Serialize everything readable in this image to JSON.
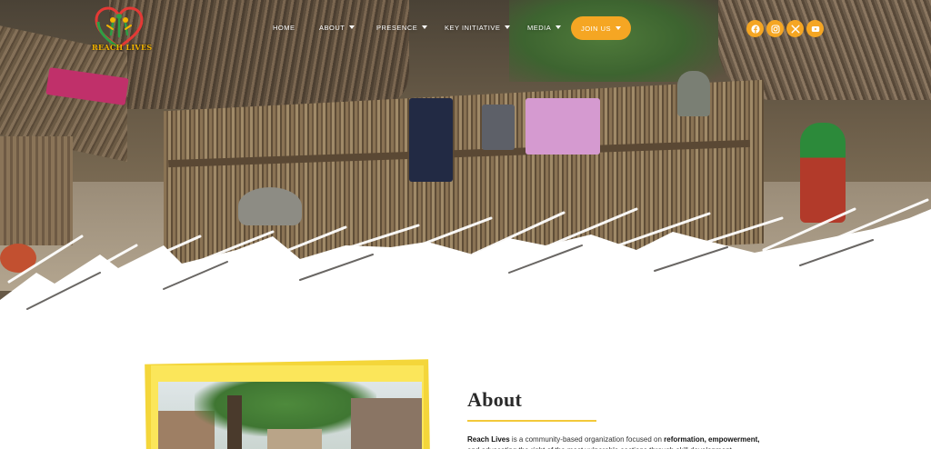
{
  "brand": {
    "name": "Reach Lives",
    "logo_text": "REACH LIVES",
    "colors": {
      "accent": "#f5a623",
      "logo_yellow": "#f3b400",
      "rule": "#f3c93a"
    }
  },
  "nav": {
    "items": [
      {
        "label": "HOME",
        "has_dropdown": false
      },
      {
        "label": "ABOUT",
        "has_dropdown": true
      },
      {
        "label": "PRESENCE",
        "has_dropdown": true
      },
      {
        "label": "KEY INITIATIVE",
        "has_dropdown": true
      },
      {
        "label": "MEDIA",
        "has_dropdown": true
      }
    ],
    "cta": {
      "label": "JOIN US",
      "has_dropdown": true
    },
    "social": [
      {
        "icon": "facebook-icon"
      },
      {
        "icon": "instagram-icon"
      },
      {
        "icon": "x-twitter-icon"
      },
      {
        "icon": "youtube-icon"
      }
    ]
  },
  "about": {
    "title": "About",
    "lead_name": "Reach Lives",
    "lead_mid": " is a community-based organization focused on ",
    "bold_1": "reformation,",
    "bold_2": "empowerment,",
    "line_2": "and advocating the right of the most vulnerable sections through skill development"
  }
}
